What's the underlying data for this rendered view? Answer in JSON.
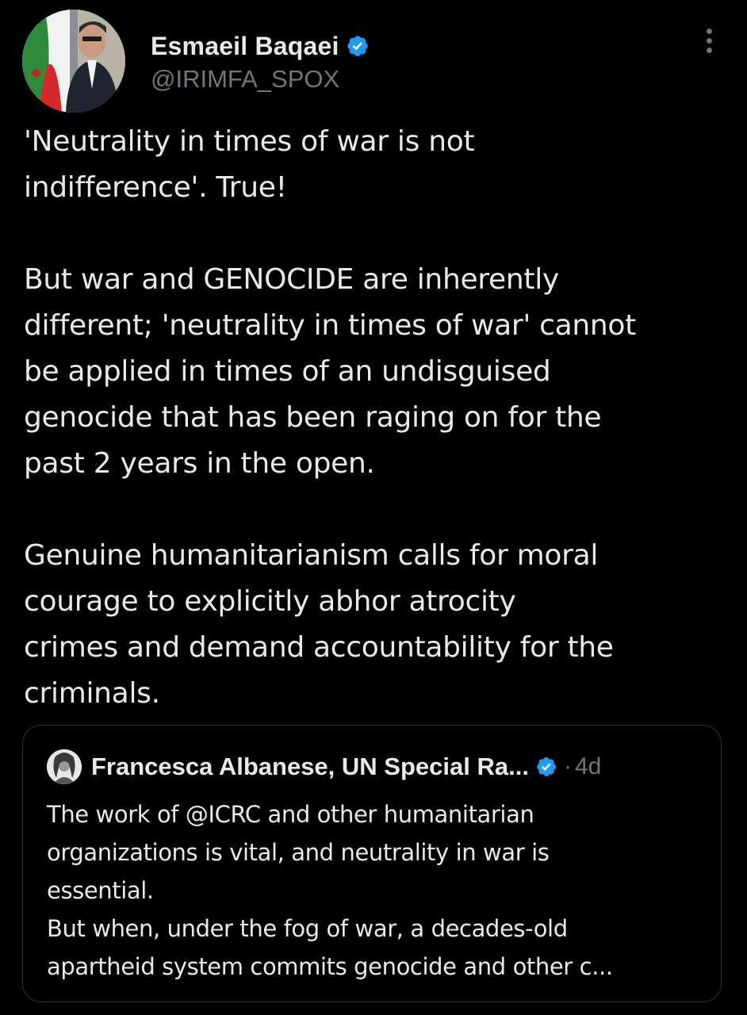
{
  "tweet": {
    "author": {
      "display_name": "Esmaeil Baqaei",
      "handle": "@IRIMFA_SPOX",
      "verified": true,
      "verified_icon": "verified-badge-icon"
    },
    "more_icon": "more-options-icon",
    "paragraphs": [
      "'Neutrality in times of war is not\nindifference'. True!",
      "But war and GENOCIDE are inherently\ndifferent; 'neutrality in times of war' cannot\nbe applied in times of an undisguised\ngenocide that has been raging on for the\npast 2 years in the open.",
      "Genuine humanitarianism calls for moral\ncourage to explicitly abhor atrocity\ncrimes and demand accountability for the\ncriminals."
    ]
  },
  "quote": {
    "author": {
      "display_name": "Francesca Albanese, UN Special Ra...",
      "verified": true
    },
    "separator": "·",
    "time": "4d",
    "lines": [
      "The work of @ICRC and other humanitarian",
      "organizations is vital, and neutrality in war is",
      "essential.",
      "But when, under the fog of war, a decades-old",
      "apartheid system commits genocide and other c..."
    ]
  },
  "colors": {
    "background": "#000000",
    "text": "#e7e9ea",
    "secondary": "#71767b",
    "verified": "#1d9bf0",
    "border": "#2f3336"
  }
}
